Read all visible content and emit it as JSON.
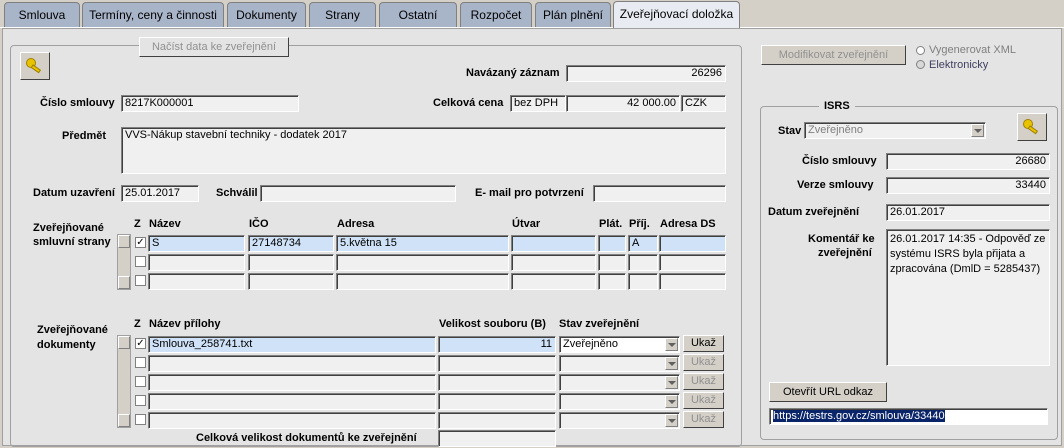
{
  "tabs": [
    "Smlouva",
    "Termíny, ceny a činnosti",
    "Dokumenty",
    "Strany",
    "Ostatní",
    "Rozpočet",
    "Plán plnění",
    "Zveřejňovací doložka"
  ],
  "top": {
    "load_button": "Načíst data ke zveřejnění",
    "modify_button": "Modifikovat zveřejnění",
    "radio_xml": "Vygenerovat XML",
    "radio_electronic": "Elektronicky"
  },
  "contract": {
    "linked_label": "Navázaný záznam",
    "linked_value": "26296",
    "number_label": "Číslo smlouvy",
    "number_value": "8217K000001",
    "price_label": "Celková cena",
    "price_type": "bez DPH",
    "price_value": "42 000.00",
    "currency": "CZK",
    "subject_label": "Předmět",
    "subject_value": "VVS-Nákup stavební techniky - dodatek 2017",
    "concluded_label": "Datum uzavření",
    "concluded_value": "25.01.2017",
    "approved_label": "Schválil",
    "approved_value": "",
    "email_label": "E- mail pro potvrzení",
    "email_value": ""
  },
  "parties": {
    "section_label_1": "Zveřejňované",
    "section_label_2": "smluvní strany",
    "headers": {
      "z": "Z",
      "name": "Název",
      "ico": "IČO",
      "address": "Adresa",
      "unit": "Útvar",
      "payer": "Plát.",
      "recipient": "Příj.",
      "address_ds": "Adresa DS"
    },
    "rows": [
      {
        "name": "S",
        "ico": "27148734",
        "address": "5.května 15",
        "unit": "",
        "payer": "",
        "recipient": "A",
        "address_ds": ""
      }
    ]
  },
  "documents": {
    "section_label_1": "Zveřejňované",
    "section_label_2": "dokumenty",
    "headers": {
      "z": "Z",
      "name": "Název přílohy",
      "size": "Velikost souboru (B)",
      "status": "Stav zveřejnění"
    },
    "rows": [
      {
        "name": "Smlouva_258741.txt",
        "size": "11",
        "status": "Zveřejněno"
      }
    ],
    "show_button": "Ukaž",
    "total_label": "Celková velikost dokumentů ke zveřejnění",
    "total_value": ""
  },
  "isrs": {
    "title": "ISRS",
    "state_label": "Stav",
    "state_value": "Zveřejněno",
    "number_label": "Číslo smlouvy",
    "number_value": "26680",
    "version_label": "Verze smlouvy",
    "version_value": "33440",
    "date_label": "Datum zveřejnění",
    "date_value": "26.01.2017",
    "comment_label_1": "Komentář ke",
    "comment_label_2": "zveřejnění",
    "comment_value": "26.01.2017 14:35 - Odpověď ze systému ISRS byla přijata a zpracována (DmlD = 5285437)",
    "url_button": "Otevřít URL odkaz",
    "url_value": "https://testrs.gov.cz/smlouva/33440"
  }
}
